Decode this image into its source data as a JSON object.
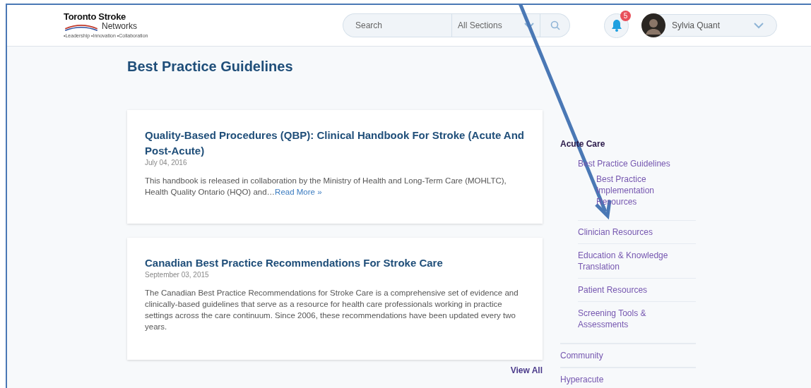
{
  "header": {
    "logo": {
      "name": "Toronto Stroke",
      "sub": "Networks",
      "tagline": "•Leadership •Innovation •Collaboration"
    },
    "search": {
      "placeholder": "Search",
      "section": "All Sections"
    },
    "notifications": {
      "count": "5"
    },
    "user": {
      "name": "Sylvia Quant"
    }
  },
  "page_title": "Best Practice Guidelines",
  "articles": [
    {
      "title": "Quality-Based Procedures (QBP): Clinical Handbook For Stroke (Acute And Post-Acute)",
      "date": "July 04, 2016",
      "excerpt": "This handbook is released in collaboration by the Ministry of Health and Long-Term Care (MOHLTC), Health Quality Ontario (HQO) and…",
      "read_more": "Read More »"
    },
    {
      "title": "Canadian Best Practice Recommendations For Stroke Care",
      "date": "September 03, 2015",
      "excerpt": "The Canadian Best Practice Recommendations for Stroke Care is a comprehensive set of evidence and clinically-based guidelines that serve as a resource for health care professionals working in practice settings across the care continuum. Since 2006, these recommendations have been updated every two years."
    }
  ],
  "view_all": "View All",
  "sidebar": {
    "items": [
      {
        "label": "Acute Care",
        "selected": true,
        "children": [
          {
            "label": "Best Practice Guidelines",
            "selected": false,
            "children": [
              {
                "label": "Best Practice Implementation Resources",
                "selected": false
              }
            ]
          },
          {
            "label": "Clinician Resources",
            "selected": false
          },
          {
            "label": "Education & Knowledge Translation",
            "selected": false
          },
          {
            "label": "Patient Resources",
            "selected": false
          },
          {
            "label": "Screening Tools & Assessments",
            "selected": false
          }
        ]
      },
      {
        "label": "Community",
        "selected": false
      },
      {
        "label": "Hyperacute",
        "selected": false
      }
    ]
  }
}
